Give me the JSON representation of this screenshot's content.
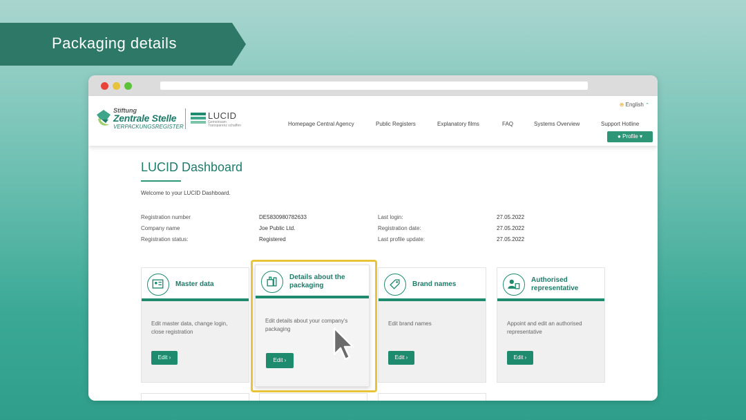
{
  "banner": {
    "title": "Packaging details"
  },
  "header": {
    "logo_zs": {
      "line1": "Stiftung",
      "line2": "Zentrale Stelle",
      "line3": "VERPACKUNGSREGISTER"
    },
    "logo_lucid": {
      "word": "LUCID",
      "tagline_1": "Gemeinsam",
      "tagline_2": "Transparenz schaffen"
    },
    "language": "English",
    "nav": [
      {
        "label": "Homepage Central Agency"
      },
      {
        "label": "Public Registers"
      },
      {
        "label": "Explanatory films"
      },
      {
        "label": "FAQ"
      },
      {
        "label": "Systems Overview"
      },
      {
        "label": "Support Hotline"
      }
    ],
    "profile_label": "Profile"
  },
  "dashboard": {
    "title": "LUCID Dashboard",
    "welcome": "Welcome to your LUCID Dashboard.",
    "info_left": [
      {
        "label": "Registration number",
        "value": "DE5830980782633"
      },
      {
        "label": "Company name",
        "value": "Joe Public Ltd."
      },
      {
        "label": "Registration status:",
        "value": "Registered"
      }
    ],
    "info_right": [
      {
        "label": "Last login:",
        "value": "27.05.2022"
      },
      {
        "label": "Registration date:",
        "value": "27.05.2022"
      },
      {
        "label": "Last profile update:",
        "value": "27.05.2022"
      }
    ],
    "cards": [
      {
        "title": "Master data",
        "description": "Edit master data, change login, close registration",
        "button": "Edit"
      },
      {
        "title": "Details about the packaging",
        "description": "Edit details about your company's packaging",
        "button": "Edit"
      },
      {
        "title": "Brand names",
        "description": "Edit brand names",
        "button": "Edit"
      },
      {
        "title": "Authorised representative",
        "description": "Appoint and edit an authorised representative",
        "button": "Edit"
      }
    ]
  },
  "colors": {
    "brand_green": "#1e8a6e",
    "banner_green": "#2d7866",
    "highlight_yellow": "#e8c43a"
  }
}
